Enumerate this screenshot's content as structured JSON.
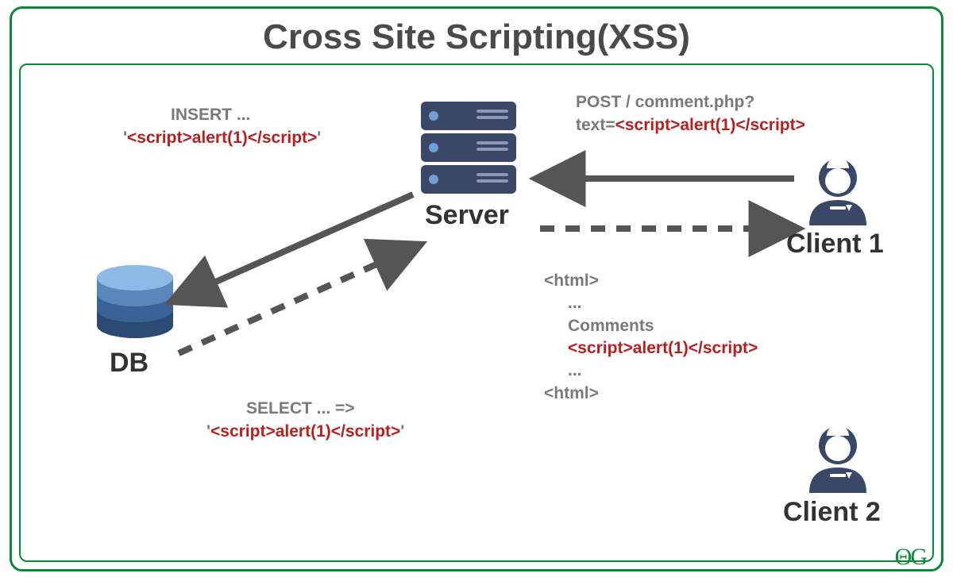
{
  "title": "Cross Site Scripting(XSS)",
  "logo": "ΘG",
  "nodes": {
    "server": "Server",
    "db": "DB",
    "client1": "Client 1",
    "client2": "Client 2"
  },
  "insert": {
    "line1": "INSERT ...",
    "q1": "'",
    "payload": "<script>alert(1)</script>",
    "q2": "'"
  },
  "post": {
    "line1": "POST / comment.php?",
    "prefix": "text=",
    "payload": "<script>alert(1)</script>"
  },
  "select": {
    "line1": "SELECT ... =>",
    "q1": "'",
    "payload": "<script>alert(1)</script>",
    "q2": "'"
  },
  "html_out": {
    "open": "<html>",
    "dots1": "...",
    "comments": "Comments",
    "payload": "<script>alert(1)</script>",
    "dots2": "...",
    "close": "<html>"
  }
}
